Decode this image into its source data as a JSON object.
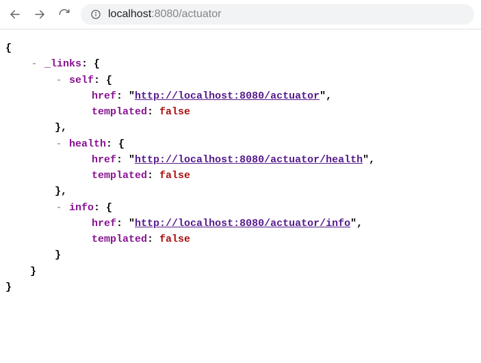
{
  "toolbar": {
    "url_host": "localhost",
    "url_port": ":8080",
    "url_path": "/actuator"
  },
  "json": {
    "root_open": "{",
    "links_key": "_links",
    "self_key": "self",
    "health_key": "health",
    "info_key": "info",
    "href_key": "href",
    "templated_key": "templated",
    "open_brace": "{",
    "close_brace": "}",
    "close_brace_comma": "},",
    "colon_space": ": ",
    "quote": "\"",
    "comma": ",",
    "toggle": "-",
    "self_href": "http://localhost:8080/actuator",
    "health_href": "http://localhost:8080/actuator/health",
    "info_href": "http://localhost:8080/actuator/info",
    "templated_value": "false"
  }
}
